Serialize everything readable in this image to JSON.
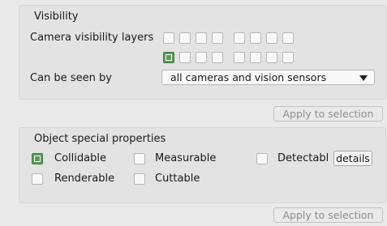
{
  "visibility": {
    "title": "Visibility",
    "camera_layers_label": "Camera visibility layers",
    "layers_row1": [
      false,
      false,
      false,
      false,
      false,
      false,
      false,
      false
    ],
    "layers_row2": [
      true,
      false,
      false,
      false,
      false,
      false,
      false,
      false
    ],
    "seen_by_label": "Can be seen by",
    "seen_by_value": "all cameras and vision sensors",
    "apply_label": "Apply to selection"
  },
  "properties": {
    "title": "Object special properties",
    "collidable": {
      "label": "Collidable",
      "checked": true
    },
    "measurable": {
      "label": "Measurable",
      "checked": false
    },
    "detectable": {
      "label": "Detectabl",
      "checked": false
    },
    "details_label": "details",
    "renderable": {
      "label": "Renderable",
      "checked": false
    },
    "cuttable": {
      "label": "Cuttable",
      "checked": false
    },
    "apply_label": "Apply to selection"
  }
}
